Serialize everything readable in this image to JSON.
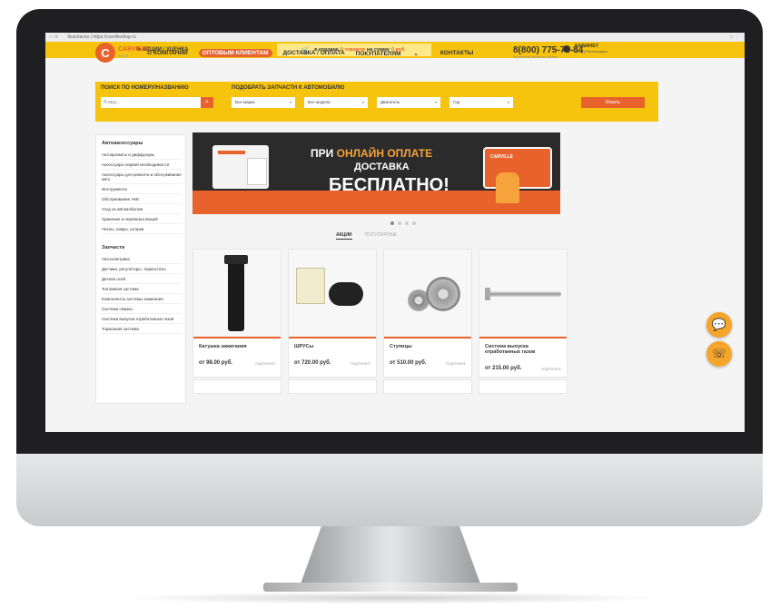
{
  "browser": {
    "url": "безопасно | https://carvilleshop.ru"
  },
  "topbar": {
    "promo": "% АКЦИИ / УЦЕНКА",
    "cart_prefix": "в корзине",
    "cart_count": "0 товаров",
    "cart_mid": "на сумму",
    "cart_sum": "0 руб.",
    "account_title": "КАБИНЕТ",
    "account_sub": "Вход | Регистрация"
  },
  "header": {
    "logo_name": "CARVILLE",
    "logo_sub": "SHOP",
    "phone": "8(800) 775-78-84",
    "phone_sub": "бесплатный звонок по России",
    "nav": [
      "О КОМПАНИИ",
      "ОПТОВЫМ КЛИЕНТАМ",
      "ДОСТАВКА / ОПЛАТА",
      "ПОКУПАТЕЛЯМ",
      "КОНТАКТЫ"
    ]
  },
  "search": {
    "title_left": "ПОИСК ПО НОМЕРУ/НАЗВАНИЮ",
    "title_right": "ПОДОБРАТЬ ЗАПЧАСТИ К АВТОМОБИЛЮ",
    "placeholder": "Я ищу...",
    "selects": [
      "Все марки",
      "Все модели",
      "Двигатель",
      "Год"
    ],
    "find_label": "Искать"
  },
  "sidebar": {
    "cat1": "Автоаксессуары",
    "items1": [
      "Автоароматы и диффузоры",
      "Аксессуары первой необходимости",
      "Аксессуары для ремонта и обслуживания авто",
      "Инструменты",
      "Обслуживание АКБ",
      "Уход за автомобилем",
      "Хранение и перевозка вещей",
      "Чехлы, ковры, шторки"
    ],
    "cat2": "Запчасти",
    "items2": [
      "Автоэлектрика",
      "Датчики, регуляторы, термостаты",
      "Детали осей",
      "Топливная система",
      "Компоненты системы зажигания",
      "Система смазки",
      "Система выпуска отработанных газов",
      "Тормозная система"
    ]
  },
  "banner": {
    "line1_a": "ПРИ",
    "line1_b": "ОНЛАЙН ОПЛАТЕ",
    "line2": "ДОСТАВКА",
    "line3": "БЕСПЛАТНО!",
    "truck_brand": "CARVILLE",
    "slides": 4,
    "active_slide": 0
  },
  "tabs": [
    "АКЦИИ",
    "ПОПУЛЯРНЫЕ"
  ],
  "products": [
    {
      "name": "Катушка зажигания",
      "price": "от 98.00 руб.",
      "more": "ПОДРОБНЕЕ"
    },
    {
      "name": "ШРУСы",
      "price": "от 720.00 руб.",
      "more": "ПОДРОБНЕЕ"
    },
    {
      "name": "Ступицы",
      "price": "от 510.00 руб.",
      "more": "ПОДРОБНЕЕ"
    },
    {
      "name": "Система выпуска отработанных газов",
      "price": "от 215.00 руб.",
      "more": "ПОДРОБНЕЕ"
    }
  ],
  "icons": {
    "chat": "chat-icon",
    "phone": "phone-icon",
    "search": "search-icon",
    "cart": "cart-icon",
    "user": "user-icon"
  },
  "colors": {
    "accent": "#e8622c",
    "yellow": "#f6c30f",
    "fab": "#f6a52b"
  }
}
